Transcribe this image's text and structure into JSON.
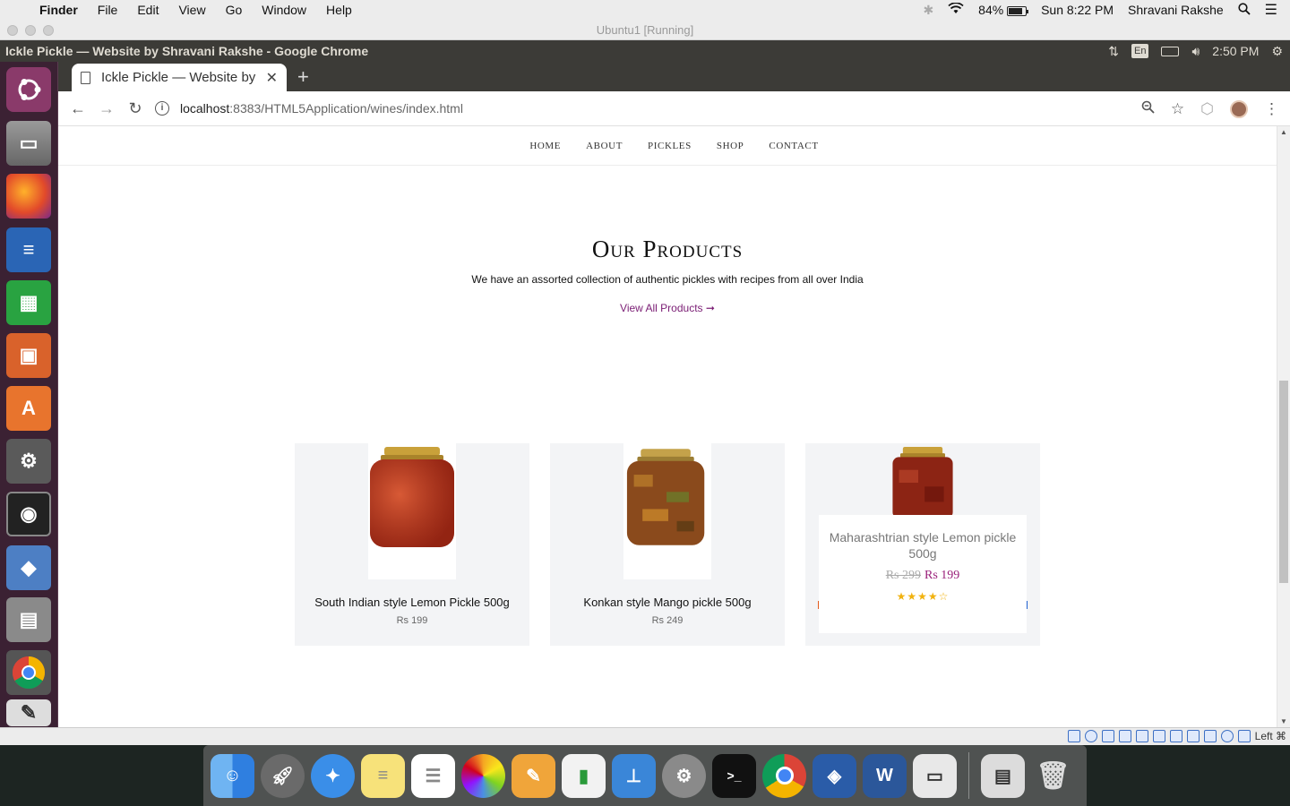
{
  "mac_menubar": {
    "app": "Finder",
    "menus": [
      "File",
      "Edit",
      "View",
      "Go",
      "Window",
      "Help"
    ],
    "battery": "84%",
    "datetime": "Sun 8:22 PM",
    "user": "Shravani Rakshe"
  },
  "vbox": {
    "title": "Ubuntu1 [Running]",
    "host_key": "Left ⌘"
  },
  "ubuntu": {
    "window_title": "Ickle Pickle — Website by Shravani Rakshe - Google Chrome",
    "lang": "En",
    "time": "2:50 PM"
  },
  "chrome": {
    "tab_title": "Ickle Pickle — Website by Shravani Rakshe",
    "url_host": "localhost",
    "url_path": ":8383/HTML5Application/wines/index.html"
  },
  "site": {
    "nav": [
      "HOME",
      "ABOUT",
      "PICKLES",
      "SHOP",
      "CONTACT"
    ],
    "heading": "Our Products",
    "subtitle": "We have an assorted collection of authentic pickles with recipes from all over India",
    "view_all": "View All Products ➞",
    "products": [
      {
        "name": "South Indian style Lemon Pickle 500g",
        "price": "Rs 199"
      },
      {
        "name": "Konkan style Mango pickle 500g",
        "price": "Rs 249"
      },
      {
        "name": "Maharashtrian style Lemon pickle 500g",
        "old_price": "Rs 299",
        "price": "Rs 199",
        "rating": 4,
        "stars": "★★★★☆"
      }
    ]
  }
}
